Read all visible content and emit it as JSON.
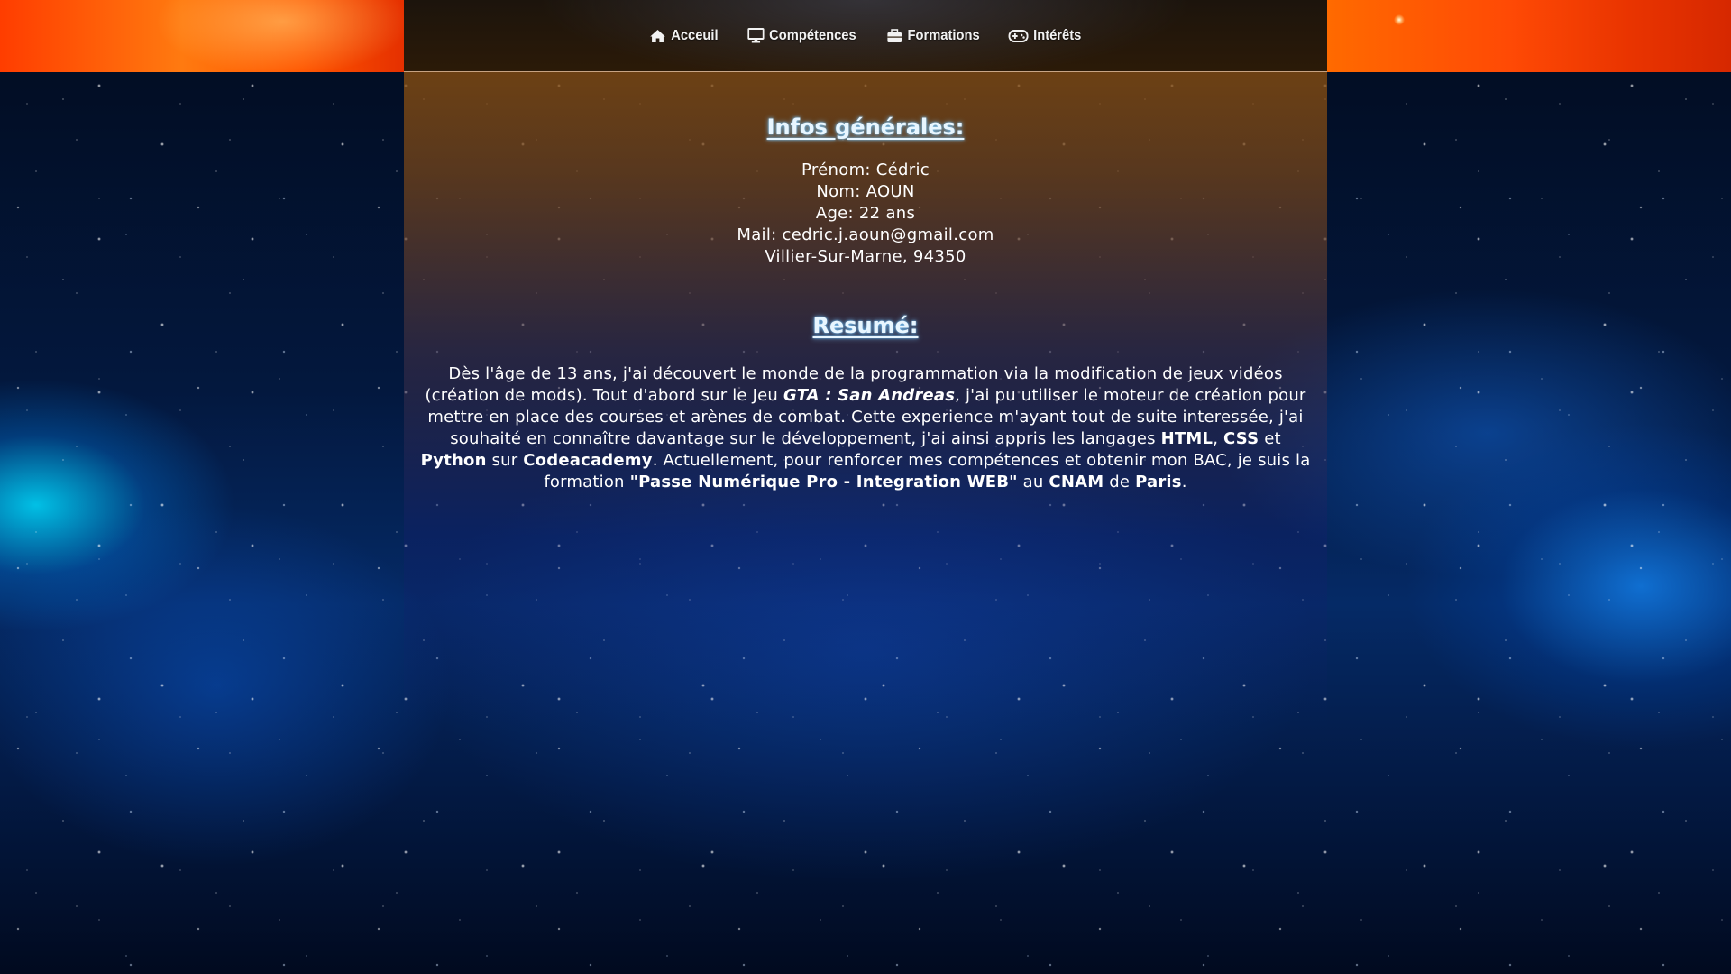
{
  "nav": {
    "items": [
      {
        "label": "Acceuil",
        "icon": "home-icon"
      },
      {
        "label": "Compétences",
        "icon": "desktop-icon"
      },
      {
        "label": "Formations",
        "icon": "briefcase-icon"
      },
      {
        "label": "Intérêts",
        "icon": "gamepad-icon"
      }
    ]
  },
  "infos": {
    "title": "Infos générales:",
    "prenom": "Prénom: Cédric",
    "nom": "Nom: AOUN",
    "age": "Age: 22 ans",
    "mail": "Mail: cedric.j.aoun@gmail.com",
    "adresse": "Villier-Sur-Marne, 94350"
  },
  "resume": {
    "title": "Resumé:",
    "p1": "Dès l'âge de 13 ans, j'ai découvert le monde de la programmation via la modification de jeux vidéos (création de mods). Tout d'abord sur le Jeu ",
    "game": "GTA : San Andreas",
    "p2": ", j'ai pu utiliser le moteur de création pour mettre en place des courses et arènes de combat. Cette experience m'ayant tout de suite interessée, j'ai souhaité en connaître davantage sur le développement, j'ai ainsi appris les langages ",
    "lang1": "HTML",
    "sep1": ", ",
    "lang2": "CSS",
    "sep2": " et ",
    "lang3": "Python",
    "sep3": " sur ",
    "platform": "Codeacademy",
    "p3": ". Actuellement, pour renforcer mes compétences et obtenir mon BAC, je suis la formation ",
    "formation": "\"Passe Numérique Pro - Integration WEB\"",
    "p4": " au ",
    "school": "CNAM",
    "p5": " de ",
    "city": "Paris",
    "p6": "."
  },
  "colors": {
    "banner_orange": "#ff6a00",
    "navbar_bg": "#2b1a08",
    "title_glow": "#78c8ff",
    "space_blue": "#052a66"
  }
}
